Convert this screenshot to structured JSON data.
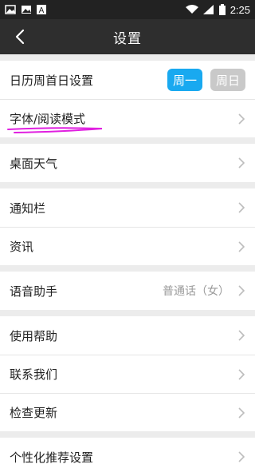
{
  "status_bar": {
    "time": "2:25",
    "icons": [
      "gallery-icon",
      "notification-icon",
      "image-icon",
      "text-icon",
      "wifi-icon",
      "signal-icon",
      "battery-icon"
    ]
  },
  "header": {
    "title": "设置",
    "back_icon": "back-arrow-icon"
  },
  "groups": [
    [
      {
        "label": "日历周首日设置",
        "options": [
          "周一",
          "周日"
        ],
        "selected": "周一"
      },
      {
        "label": "字体/阅读模式",
        "highlight_color": "#e020e0"
      }
    ],
    [
      {
        "label": "桌面天气"
      }
    ],
    [
      {
        "label": "通知栏"
      },
      {
        "label": "资讯"
      }
    ],
    [
      {
        "label": "语音助手",
        "value": "普通话（女）"
      }
    ],
    [
      {
        "label": "使用帮助"
      },
      {
        "label": "联系我们"
      },
      {
        "label": "检查更新"
      }
    ],
    [
      {
        "label": "个性化推荐设置"
      }
    ]
  ],
  "colors": {
    "accent": "#19a9f0",
    "header_bg": "#2e2e2e",
    "page_bg": "#ececec"
  }
}
